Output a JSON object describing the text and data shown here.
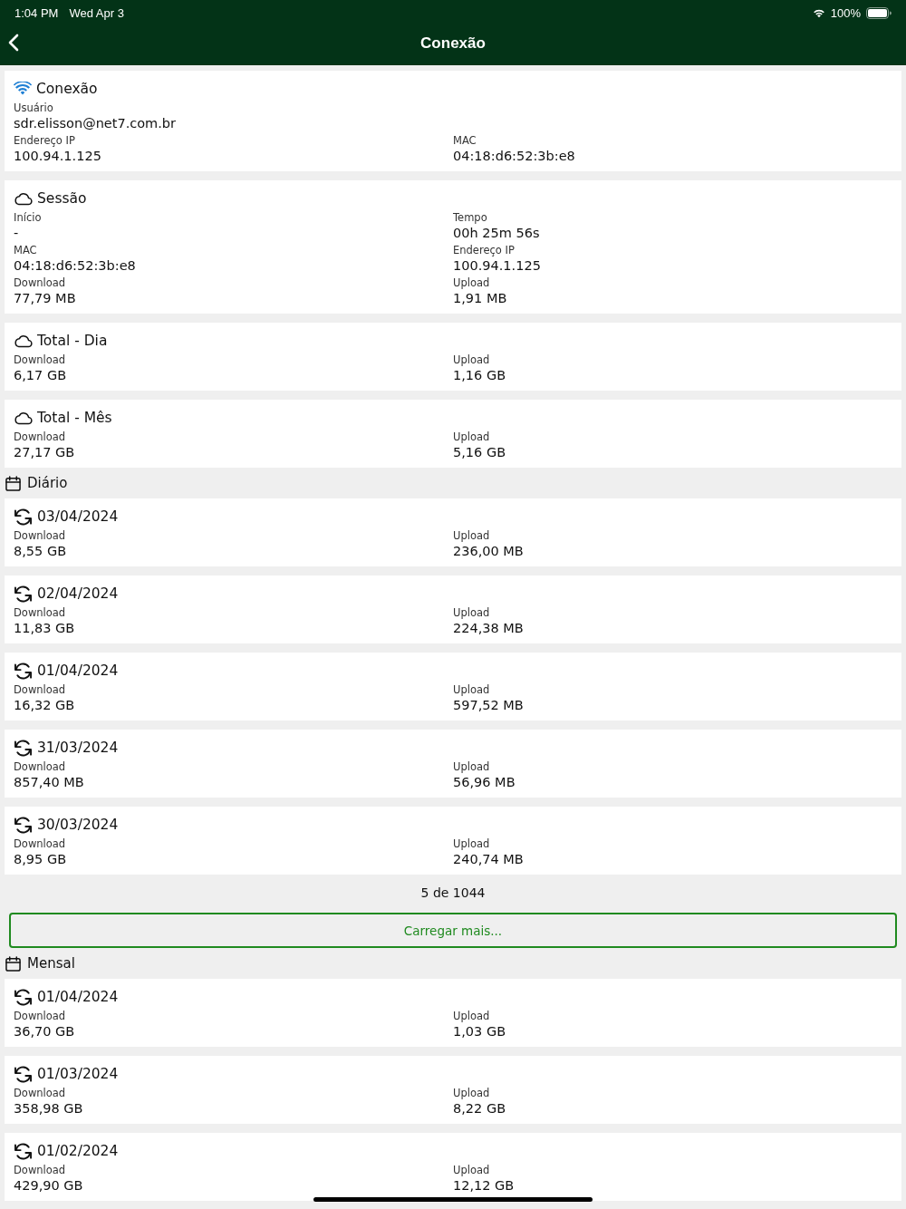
{
  "status_bar": {
    "time": "1:04 PM",
    "date": "Wed Apr 3",
    "battery": "100%"
  },
  "nav": {
    "title": "Conexão"
  },
  "items": [
    {
      "kind": "connection",
      "title": "Conexão",
      "rows": [
        [
          {
            "label": "Usuário",
            "value": "sdr.elisson@net7.com.br"
          }
        ],
        [
          {
            "label": "Endereço IP",
            "value": "100.94.1.125"
          },
          {
            "label": "MAC",
            "value": "04:18:d6:52:3b:e8"
          }
        ]
      ]
    },
    {
      "kind": "usage",
      "title": "Sessão",
      "rows": [
        [
          {
            "label": "Início",
            "value": "-"
          },
          {
            "label": "Tempo",
            "value": "00h 25m 56s"
          }
        ],
        [
          {
            "label": "MAC",
            "value": "04:18:d6:52:3b:e8"
          },
          {
            "label": "Endereço IP",
            "value": "100.94.1.125"
          }
        ],
        [
          {
            "label": "Download",
            "value": "77,79 MB"
          },
          {
            "label": "Upload",
            "value": "1,91 MB"
          }
        ]
      ]
    },
    {
      "kind": "usage",
      "title": "Total - Dia",
      "rows": [
        [
          {
            "label": "Download",
            "value": "6,17 GB"
          },
          {
            "label": "Upload",
            "value": "1,16 GB"
          }
        ]
      ]
    },
    {
      "kind": "usage",
      "title": "Total - Mês",
      "rows": [
        [
          {
            "label": "Download",
            "value": "27,17 GB"
          },
          {
            "label": "Upload",
            "value": "5,16 GB"
          }
        ]
      ]
    },
    {
      "kind": "group",
      "title": "Diário"
    },
    {
      "kind": "entry",
      "title": "03/04/2024",
      "rows": [
        [
          {
            "label": "Download",
            "value": "8,55 GB"
          },
          {
            "label": "Upload",
            "value": "236,00 MB"
          }
        ]
      ]
    },
    {
      "kind": "entry",
      "title": "02/04/2024",
      "rows": [
        [
          {
            "label": "Download",
            "value": "11,83 GB"
          },
          {
            "label": "Upload",
            "value": "224,38 MB"
          }
        ]
      ]
    },
    {
      "kind": "entry",
      "title": "01/04/2024",
      "rows": [
        [
          {
            "label": "Download",
            "value": "16,32 GB"
          },
          {
            "label": "Upload",
            "value": "597,52 MB"
          }
        ]
      ]
    },
    {
      "kind": "entry",
      "title": "31/03/2024",
      "rows": [
        [
          {
            "label": "Download",
            "value": "857,40 MB"
          },
          {
            "label": "Upload",
            "value": "56,96 MB"
          }
        ]
      ]
    },
    {
      "kind": "entry",
      "title": "30/03/2024",
      "rows": [
        [
          {
            "label": "Download",
            "value": "8,95 GB"
          },
          {
            "label": "Upload",
            "value": "240,74 MB"
          }
        ]
      ]
    },
    {
      "kind": "counter",
      "text": "5 de 1044"
    },
    {
      "kind": "button",
      "text": "Carregar mais..."
    },
    {
      "kind": "group",
      "title": "Mensal"
    },
    {
      "kind": "entry",
      "title": "01/04/2024",
      "rows": [
        [
          {
            "label": "Download",
            "value": "36,70 GB"
          },
          {
            "label": "Upload",
            "value": "1,03 GB"
          }
        ]
      ]
    },
    {
      "kind": "entry",
      "title": "01/03/2024",
      "rows": [
        [
          {
            "label": "Download",
            "value": "358,98 GB"
          },
          {
            "label": "Upload",
            "value": "8,22 GB"
          }
        ]
      ]
    },
    {
      "kind": "entry",
      "title": "01/02/2024",
      "rows": [
        [
          {
            "label": "Download",
            "value": "429,90 GB"
          },
          {
            "label": "Upload",
            "value": "12,12 GB"
          }
        ]
      ]
    }
  ]
}
